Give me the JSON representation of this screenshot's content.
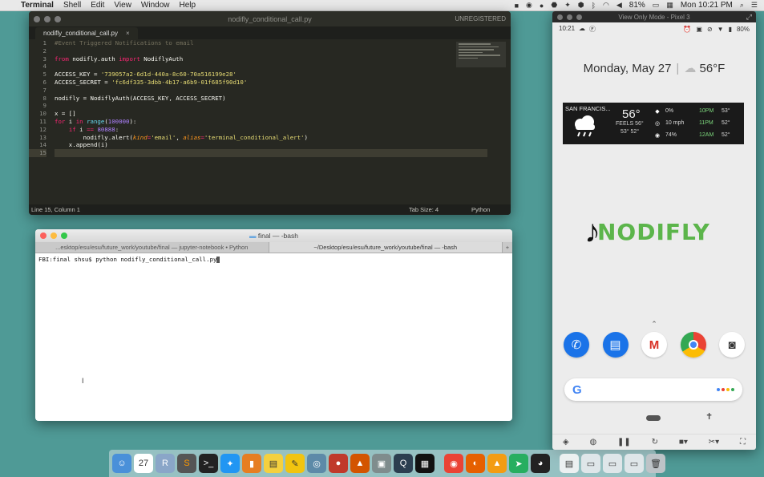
{
  "menubar": {
    "app": "Terminal",
    "menus": [
      "Shell",
      "Edit",
      "View",
      "Window",
      "Help"
    ],
    "battery": "81%",
    "clock": "Mon 10:21 PM"
  },
  "sublime": {
    "title": "nodifly_conditional_call.py",
    "license": "UNREGISTERED",
    "tab": "nodifly_conditional_call.py",
    "status_left": "Line 15, Column 1",
    "tab_size": "Tab Size: 4",
    "syntax": "Python",
    "line_numbers": [
      "1",
      "2",
      "3",
      "4",
      "5",
      "6",
      "7",
      "8",
      "9",
      "10",
      "11",
      "12",
      "13",
      "14",
      "15"
    ],
    "code": {
      "l1": "#Event Triggered Notifications to email",
      "l3_from": "from",
      "l3_mod": " nodifly.auth ",
      "l3_import": "import",
      "l3_name": " NodiflyAuth",
      "l5_var": "ACCESS_KEY = ",
      "l5_val": "'739057a2-6d1d-440a-8c60-70a516199e28'",
      "l6_var": "ACCESS_SECRET = ",
      "l6_val": "'fc6df335-3dbb-4b17-a6b9-01f685f90d10'",
      "l8": "nodifly = NodiflyAuth(ACCESS_KEY, ACCESS_SECRET)",
      "l10": "x = []",
      "l11_for": "for",
      "l11_i": " i ",
      "l11_in": "in",
      "l11_sp": " ",
      "l11_range": "range",
      "l11_open": "(",
      "l11_num": "100000",
      "l11_close": "):",
      "l12_ind": "    ",
      "l12_if": "if",
      "l12_i": " i ",
      "l12_eq": "==",
      "l12_sp": " ",
      "l12_num": "80888",
      "l12_colon": ":",
      "l13_a": "        nodifly.alert(",
      "l13_kind": "kind",
      "l13_eq1": "=",
      "l13_email": "'email'",
      "l13_comma": ", ",
      "l13_alias": "alias",
      "l13_eq2": "=",
      "l13_aval": "'terminal_conditional_alert'",
      "l13_end": ")",
      "l14": "    x.append(i)"
    }
  },
  "terminal": {
    "title": "final — -bash",
    "tabs": [
      "...esktop/esu/esu/future_work/youtube/final — jupyter-notebook • Python",
      "~/Desktop/esu/esu/future_work/youtube/final — -bash"
    ],
    "plus": "+",
    "prompt": "FBI:final shsu$ python nodifly_conditional_call.py"
  },
  "phone": {
    "title": "View Only Mode - Pixel 3",
    "time": "10:21",
    "battery": "80%",
    "date": "Monday, May 27",
    "temp": "56°F",
    "weather": {
      "city": "SAN FRANCIS...",
      "temp": "56°",
      "feels": "FEELS 56°",
      "hilo": "53° 52°",
      "details": [
        "0%",
        "10 mph",
        "74%"
      ],
      "forecast_times": [
        "10PM",
        "11PM",
        "12AM"
      ],
      "forecast_temps": [
        "53°",
        "52°",
        "52°"
      ]
    },
    "logo": "NODIFLY",
    "google_g": "G",
    "accent": "#5cb54b"
  }
}
